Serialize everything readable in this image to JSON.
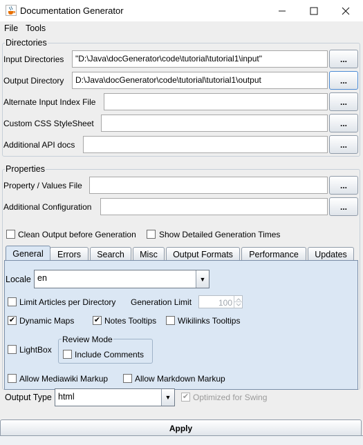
{
  "window": {
    "title": "Documentation Generator",
    "icon": "java-cup-icon",
    "minimize": "—",
    "maximize": "☐",
    "close": "✕"
  },
  "menu": {
    "file": "File",
    "tools": "Tools"
  },
  "directories": {
    "title": "Directories",
    "input_label": "Input Directories",
    "input_value": "\"D:\\Java\\docGenerator\\code\\tutorial\\tutorial1\\input\"",
    "output_label": "Output Directory",
    "output_value": "D:\\Java\\docGenerator\\code\\tutorial\\tutorial1\\output",
    "alt_index_label": "Alternate Input Index File",
    "alt_index_value": "",
    "css_label": "Custom CSS StyleSheet",
    "css_value": "",
    "api_label": "Additional API docs",
    "api_value": "",
    "browse": "..."
  },
  "properties": {
    "title": "Properties",
    "prop_file_label": "Property / Values File",
    "prop_file_value": "",
    "add_config_label": "Additional Configuration",
    "add_config_value": "",
    "browse": "..."
  },
  "options": {
    "clean_output": {
      "label": "Clean Output before Generation",
      "checked": false
    },
    "detailed_times": {
      "label": "Show Detailed Generation Times",
      "checked": false
    }
  },
  "tabs": [
    "General",
    "Errors",
    "Search",
    "Misc",
    "Output Formats",
    "Performance",
    "Updates"
  ],
  "active_tab": "General",
  "general": {
    "locale_label": "Locale",
    "locale_value": "en",
    "limit_articles": {
      "label": "Limit Articles per Directory",
      "checked": false
    },
    "generation_limit_label": "Generation Limit",
    "generation_limit_value": "100",
    "dynamic_maps": {
      "label": "Dynamic Maps",
      "checked": true
    },
    "notes_tooltips": {
      "label": "Notes Tooltips",
      "checked": true
    },
    "wikilinks_tooltips": {
      "label": "Wikilinks Tooltips",
      "checked": false
    },
    "lightbox": {
      "label": "LightBox",
      "checked": false
    },
    "review_mode_title": "Review Mode",
    "include_comments": {
      "label": "Include Comments",
      "checked": false
    },
    "allow_mediawiki": {
      "label": "Allow Mediawiki Markup",
      "checked": false
    },
    "allow_markdown": {
      "label": "Allow Markdown Markup",
      "checked": false
    },
    "output_type_label": "Output Type",
    "output_type_value": "html",
    "optimized_swing": {
      "label": "Optimized for Swing",
      "checked": true,
      "enabled": false
    }
  },
  "checkmark": "✔",
  "apply_label": "Apply"
}
